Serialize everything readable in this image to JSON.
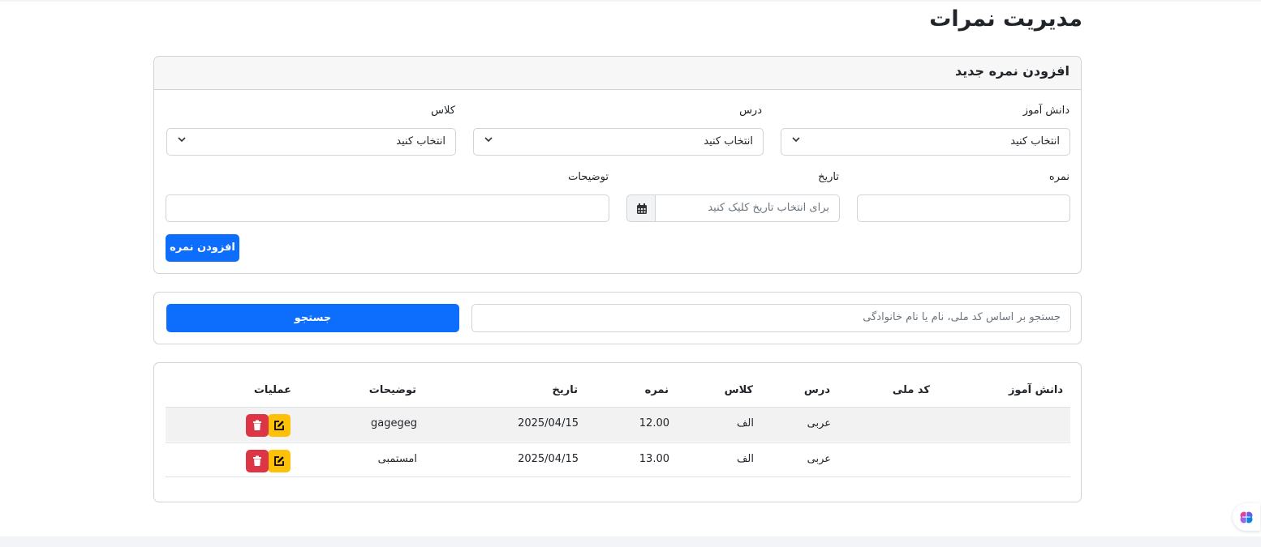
{
  "page": {
    "title": "مدیریت نمرات"
  },
  "add_form": {
    "header": "افزودن نمره جدید",
    "student_label": "دانش آموز",
    "student_value": "انتخاب کنید",
    "lesson_label": "درس",
    "lesson_value": "انتخاب کنید",
    "class_label": "کلاس",
    "class_value": "انتخاب کنید",
    "grade_label": "نمره",
    "grade_value": "",
    "date_label": "تاریخ",
    "date_placeholder": "برای انتخاب تاریخ کلیک کنید",
    "notes_label": "توضیحات",
    "notes_value": "",
    "submit_label": "افزودن نمره"
  },
  "search": {
    "placeholder": "جستجو بر اساس کد ملی، نام یا نام خانوادگی",
    "button_label": "جستجو"
  },
  "table": {
    "headers": {
      "student": "دانش آموز",
      "national_code": "کد ملی",
      "lesson": "درس",
      "class": "کلاس",
      "grade": "نمره",
      "date": "تاریخ",
      "notes": "توضیحات",
      "actions": "عملیات"
    },
    "rows": [
      {
        "student": "",
        "national_code": "",
        "lesson": "عربی",
        "class": "الف",
        "grade": "12.00",
        "date": "2025/04/15",
        "notes": "gagegeg"
      },
      {
        "student": "",
        "national_code": "",
        "lesson": "عربی",
        "class": "الف",
        "grade": "13.00",
        "date": "2025/04/15",
        "notes": "امستمبی"
      }
    ]
  },
  "colors": {
    "primary": "#0d6efd",
    "edit": "#ffc107",
    "delete": "#dc3545"
  },
  "icons": {
    "dropdown": "chevron-down-icon",
    "calendar": "calendar-icon",
    "edit": "edit-icon",
    "delete": "trash-icon",
    "widget": "brain-icon"
  }
}
